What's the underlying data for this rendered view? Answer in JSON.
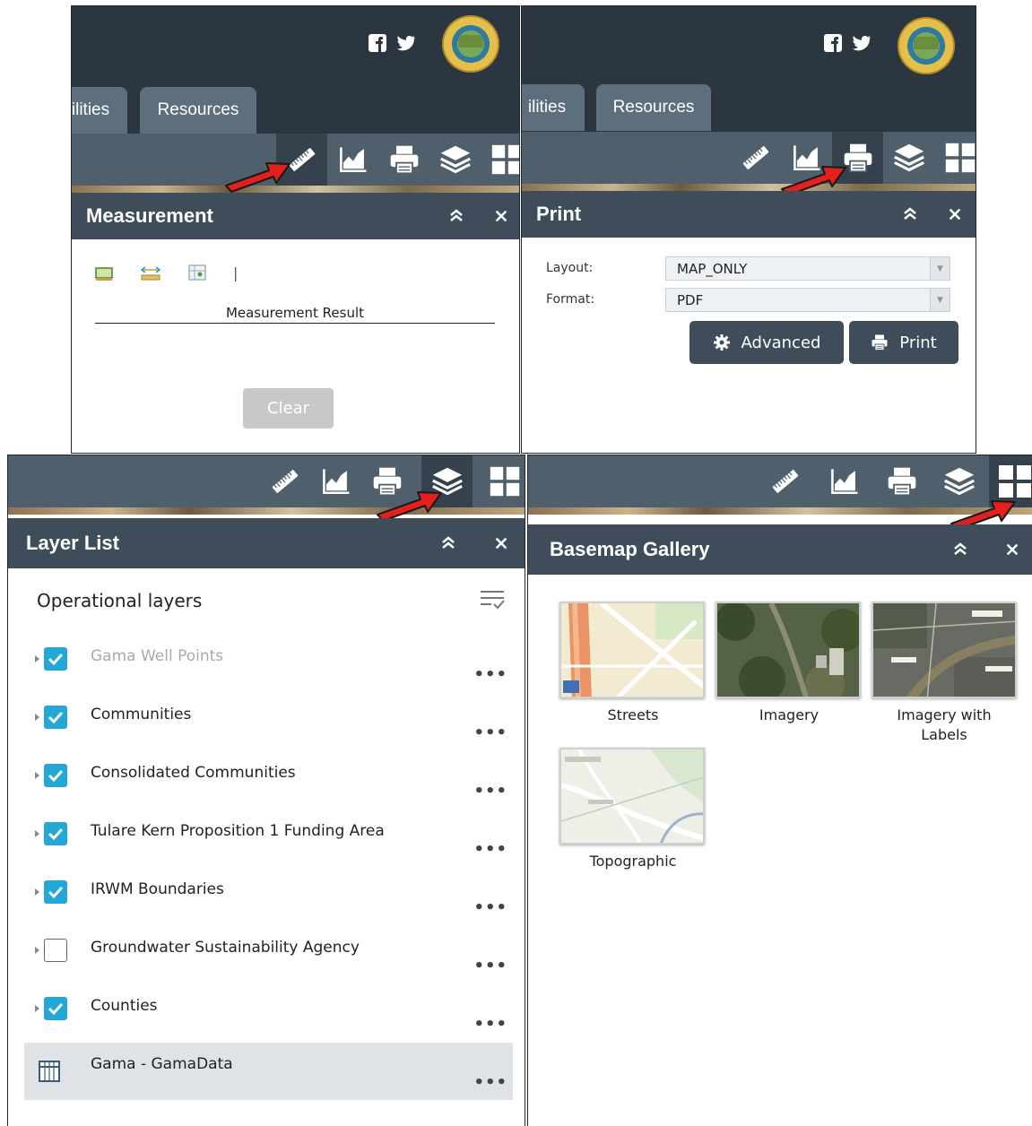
{
  "measurement_panel": {
    "tab_partial": "ilities",
    "tab_resources": "Resources",
    "title": "Measurement",
    "result_label": "Measurement Result",
    "clear_button": "Clear",
    "tool_separator": "|"
  },
  "print_panel": {
    "tab_partial": "ilities",
    "tab_resources": "Resources",
    "title": "Print",
    "layout_label": "Layout:",
    "layout_value": "MAP_ONLY",
    "format_label": "Format:",
    "format_value": "PDF",
    "advanced_button": "Advanced",
    "print_button": "Print"
  },
  "layer_list_panel": {
    "title": "Layer List",
    "section_title": "Operational layers",
    "more_glyph": "•••",
    "layers": [
      {
        "label": "Gama Well Points",
        "checked": true,
        "dimmed": true
      },
      {
        "label": "Communities",
        "checked": true
      },
      {
        "label": "Consolidated Communities",
        "checked": true
      },
      {
        "label": "Tulare Kern Proposition 1 Funding Area",
        "checked": true
      },
      {
        "label": "IRWM Boundaries",
        "checked": true
      },
      {
        "label": "Groundwater Sustainability Agency",
        "checked": false
      },
      {
        "label": "Counties",
        "checked": true
      },
      {
        "label": "Gama - GamaData",
        "table": true,
        "selected": true
      }
    ]
  },
  "basemap_panel": {
    "title": "Basemap Gallery",
    "basemaps": [
      {
        "label": "Streets"
      },
      {
        "label": "Imagery"
      },
      {
        "label": "Imagery with Labels"
      },
      {
        "label": "Topographic"
      }
    ]
  },
  "icons": {
    "collapse": "chevrons-up-icon",
    "close": "close-icon",
    "tools": [
      "ruler-icon",
      "chart-icon",
      "printer-icon",
      "layers-icon",
      "basemap-grid-icon"
    ]
  },
  "colors": {
    "header": "#2c3641",
    "toolbar": "#4f5f6c",
    "title_bar": "#3f4d5a",
    "checkbox": "#23a7d6",
    "arrow": "#e3201b"
  }
}
